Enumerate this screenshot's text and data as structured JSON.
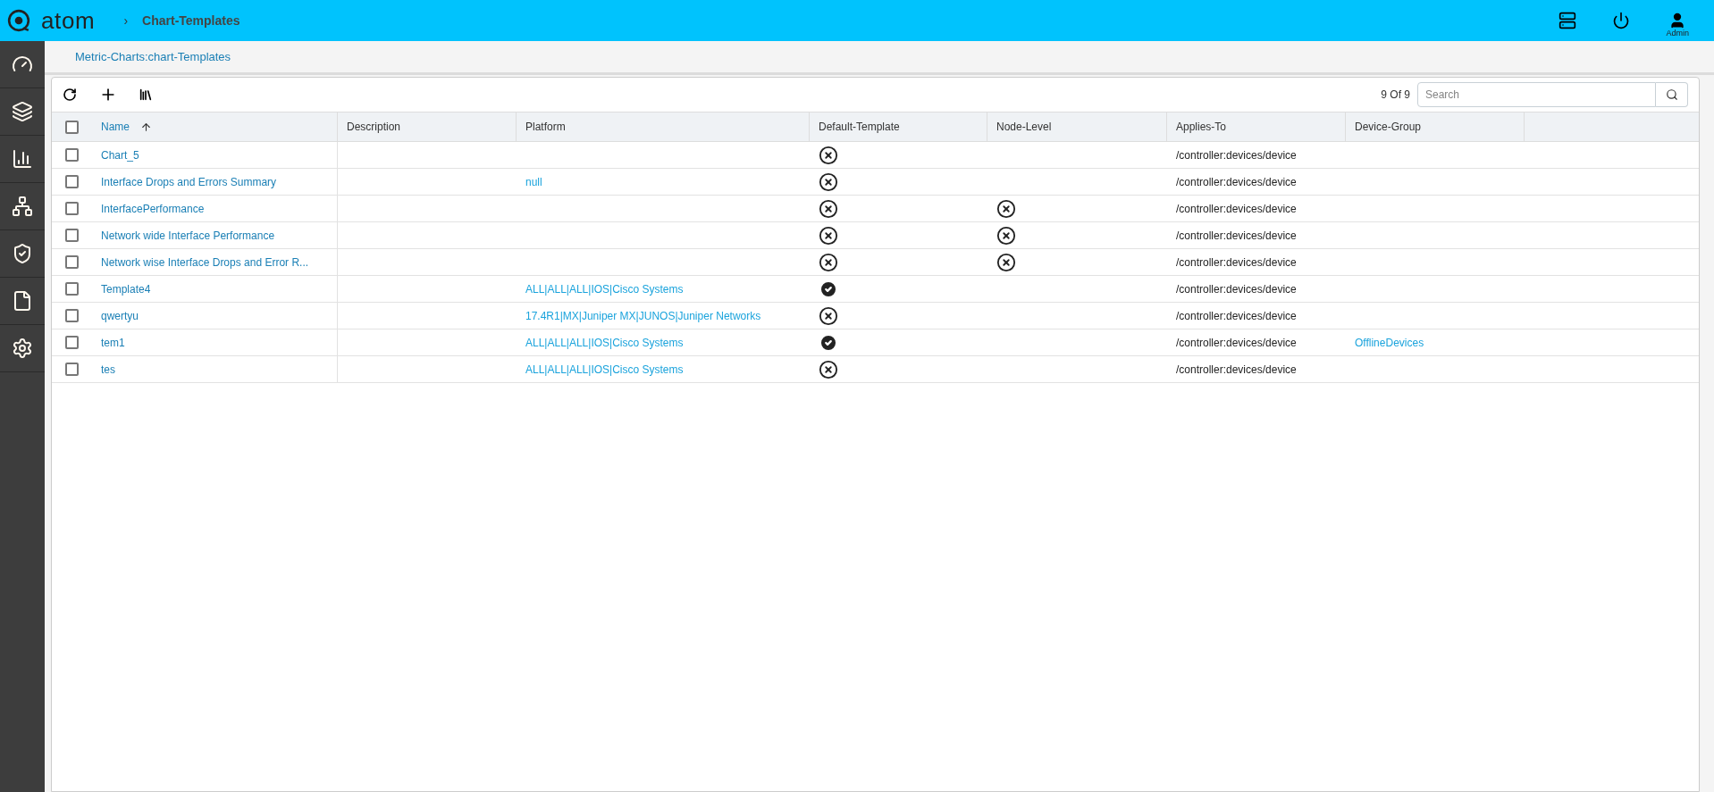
{
  "header": {
    "logo": "atom",
    "separator": "›",
    "breadcrumb": "Chart-Templates",
    "user": "Admin"
  },
  "subheader": {
    "path": "Metric-Charts:chart-Templates"
  },
  "toolbar": {
    "count": "9 Of 9",
    "search": {
      "placeholder": "Search"
    }
  },
  "table": {
    "select_all": {
      "checked": false
    },
    "columns": [
      {
        "label": "Name",
        "sorted": true
      },
      {
        "label": "Description"
      },
      {
        "label": "Platform"
      },
      {
        "label": "Default-Template"
      },
      {
        "label": "Node-Level"
      },
      {
        "label": "Applies-To"
      },
      {
        "label": "Device-Group"
      }
    ],
    "rows": [
      {
        "checked": false,
        "name": "Chart_5",
        "platform": "",
        "default_template": false,
        "applies_to": "/controller:devices/device",
        "device_group": ""
      },
      {
        "checked": false,
        "name": "Interface Drops and Errors Summary",
        "platform": "null",
        "default_template": false,
        "applies_to": "/controller:devices/device",
        "device_group": ""
      },
      {
        "checked": false,
        "name": "InterfacePerformance",
        "platform": "",
        "default_template": false,
        "node_level": false,
        "applies_to": "/controller:devices/device",
        "device_group": ""
      },
      {
        "checked": false,
        "name": "Network wide Interface Performance",
        "platform": "",
        "default_template": false,
        "node_level": false,
        "applies_to": "/controller:devices/device",
        "device_group": ""
      },
      {
        "checked": false,
        "name": "Network wise Interface Drops and Error R...",
        "platform": "",
        "default_template": false,
        "node_level": false,
        "applies_to": "/controller:devices/device",
        "device_group": ""
      },
      {
        "checked": false,
        "name": "Template4",
        "platform": "ALL|ALL|ALL|IOS|Cisco Systems",
        "default_template": true,
        "applies_to": "/controller:devices/device",
        "device_group": ""
      },
      {
        "checked": false,
        "name": "qwertyu",
        "platform": "17.4R1|MX|Juniper MX|JUNOS|Juniper Networks",
        "default_template": false,
        "applies_to": "/controller:devices/device",
        "device_group": ""
      },
      {
        "checked": false,
        "name": "tem1",
        "platform": "ALL|ALL|ALL|IOS|Cisco Systems",
        "default_template": true,
        "applies_to": "/controller:devices/device",
        "device_group": "OfflineDevices"
      },
      {
        "checked": false,
        "name": "tes",
        "platform": "ALL|ALL|ALL|IOS|Cisco Systems",
        "default_template": false,
        "applies_to": "/controller:devices/device",
        "device_group": ""
      }
    ]
  }
}
